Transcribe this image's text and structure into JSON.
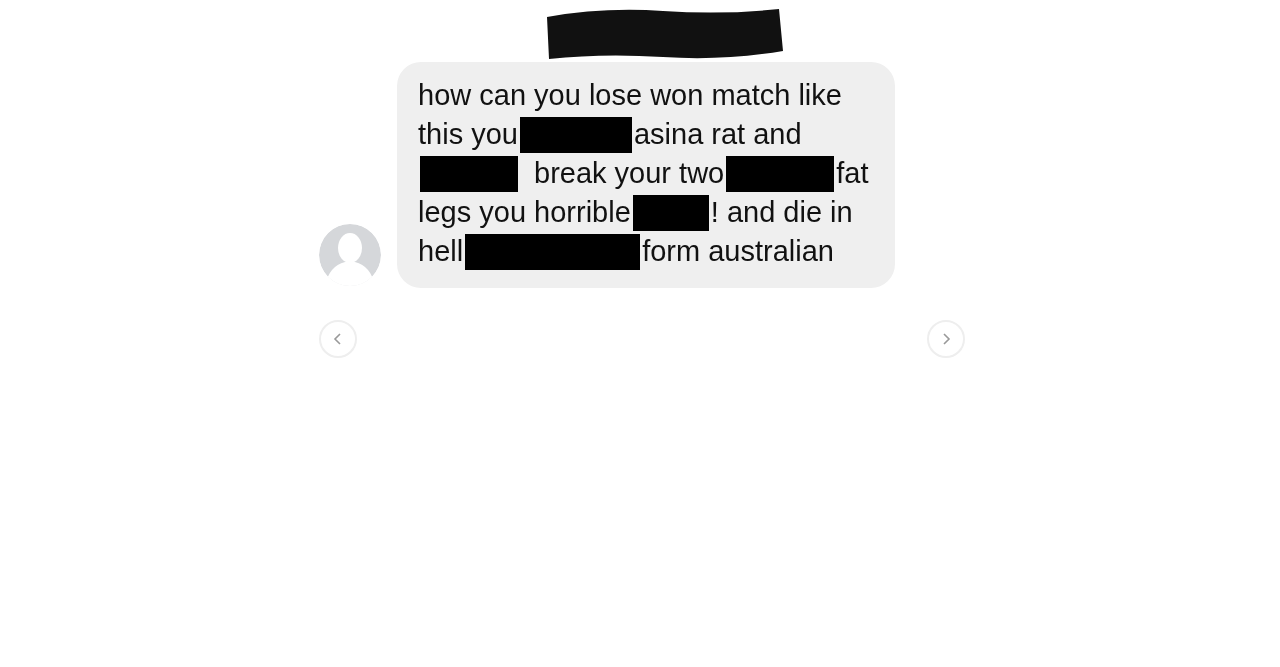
{
  "header": {
    "kind": "redaction"
  },
  "message": {
    "lines": [
      [
        {
          "kind": "text",
          "text": "how can you lose won match like"
        }
      ],
      [
        {
          "kind": "text",
          "text": "this you"
        },
        {
          "kind": "redaction"
        },
        {
          "kind": "text",
          "text": "asina rat and"
        }
      ],
      [
        {
          "kind": "redaction"
        },
        {
          "kind": "text",
          "text": "break your two"
        },
        {
          "kind": "redaction"
        },
        {
          "kind": "text",
          "text": "fat"
        }
      ],
      [
        {
          "kind": "text",
          "text": "legs you horrible"
        },
        {
          "kind": "redaction"
        },
        {
          "kind": "text",
          "text": "! and die in"
        }
      ],
      [
        {
          "kind": "text",
          "text": "hell"
        },
        {
          "kind": "redaction"
        },
        {
          "kind": "text",
          "text": "form australian"
        }
      ]
    ]
  }
}
